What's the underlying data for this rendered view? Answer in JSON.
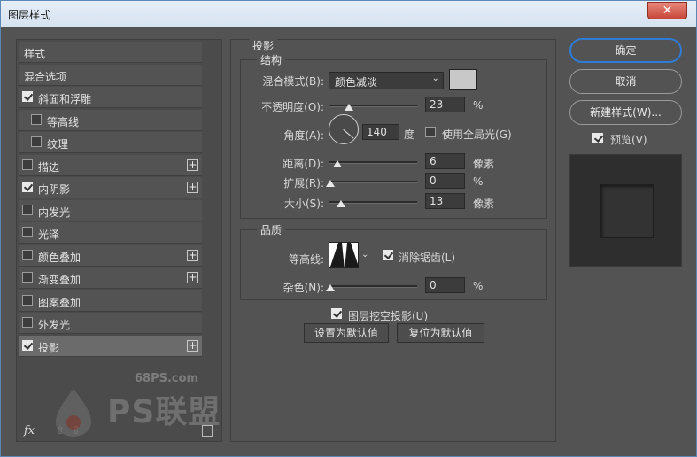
{
  "window": {
    "title": "图层样式",
    "close_glyph": "✕"
  },
  "sidebar": {
    "items": [
      {
        "label": "样式",
        "has_checkbox": false,
        "checked": false,
        "has_plus": false,
        "selected": false
      },
      {
        "label": "混合选项",
        "has_checkbox": false,
        "checked": false,
        "has_plus": false,
        "selected": false
      },
      {
        "label": "斜面和浮雕",
        "has_checkbox": true,
        "checked": true,
        "has_plus": false,
        "selected": false
      },
      {
        "label": "等高线",
        "has_checkbox": true,
        "checked": false,
        "has_plus": false,
        "selected": false,
        "indent": true
      },
      {
        "label": "纹理",
        "has_checkbox": true,
        "checked": false,
        "has_plus": false,
        "selected": false,
        "indent": true
      },
      {
        "label": "描边",
        "has_checkbox": true,
        "checked": false,
        "has_plus": true,
        "selected": false
      },
      {
        "label": "内阴影",
        "has_checkbox": true,
        "checked": true,
        "has_plus": true,
        "selected": false
      },
      {
        "label": "内发光",
        "has_checkbox": true,
        "checked": false,
        "has_plus": false,
        "selected": false
      },
      {
        "label": "光泽",
        "has_checkbox": true,
        "checked": false,
        "has_plus": false,
        "selected": false
      },
      {
        "label": "颜色叠加",
        "has_checkbox": true,
        "checked": false,
        "has_plus": true,
        "selected": false
      },
      {
        "label": "渐变叠加",
        "has_checkbox": true,
        "checked": false,
        "has_plus": true,
        "selected": false
      },
      {
        "label": "图案叠加",
        "has_checkbox": true,
        "checked": false,
        "has_plus": false,
        "selected": false
      },
      {
        "label": "外发光",
        "has_checkbox": true,
        "checked": false,
        "has_plus": false,
        "selected": false
      },
      {
        "label": "投影",
        "has_checkbox": true,
        "checked": true,
        "has_plus": true,
        "selected": true
      }
    ],
    "plus_glyph": "+",
    "footer": {
      "fx_label": "fx",
      "up_glyph": "⇧",
      "down_glyph": "⇩"
    }
  },
  "panel": {
    "heading": "投影",
    "structure": {
      "title": "结构",
      "blend_mode_label": "混合模式(B):",
      "blend_mode_value": "颜色减淡",
      "shadow_color": "#c8c8c8",
      "opacity_label": "不透明度(O):",
      "opacity_value": "23",
      "opacity_fraction": 0.23,
      "percent_unit": "%",
      "angle_label": "角度(A):",
      "angle_value": "140",
      "degree_unit": "度",
      "global_light_label": "使用全局光(G)",
      "global_light_checked": false,
      "distance_label": "距离(D):",
      "distance_value": "6",
      "spread_label": "扩展(R):",
      "spread_value": "0",
      "size_label": "大小(S):",
      "size_value": "13",
      "pixel_unit": "像素"
    },
    "quality": {
      "title": "品质",
      "contour_label": "等高线:",
      "anti_alias_label": "消除锯齿(L)",
      "anti_alias_checked": true,
      "noise_label": "杂色(N):",
      "noise_value": "0",
      "percent_unit": "%"
    },
    "knockout_label": "图层挖空投影(U)",
    "knockout_checked": true,
    "make_default_label": "设置为默认值",
    "reset_default_label": "复位为默认值"
  },
  "actions": {
    "ok_label": "确定",
    "cancel_label": "取消",
    "new_style_label": "新建样式(W)...",
    "preview_label": "预览(V)",
    "preview_checked": true
  },
  "watermark": {
    "site": "68PS.com",
    "brand": "PS联盟"
  },
  "colors": {
    "accent": "#2f7cd6",
    "panel_bg": "#535353",
    "selected_row": "#6b6b6b"
  }
}
